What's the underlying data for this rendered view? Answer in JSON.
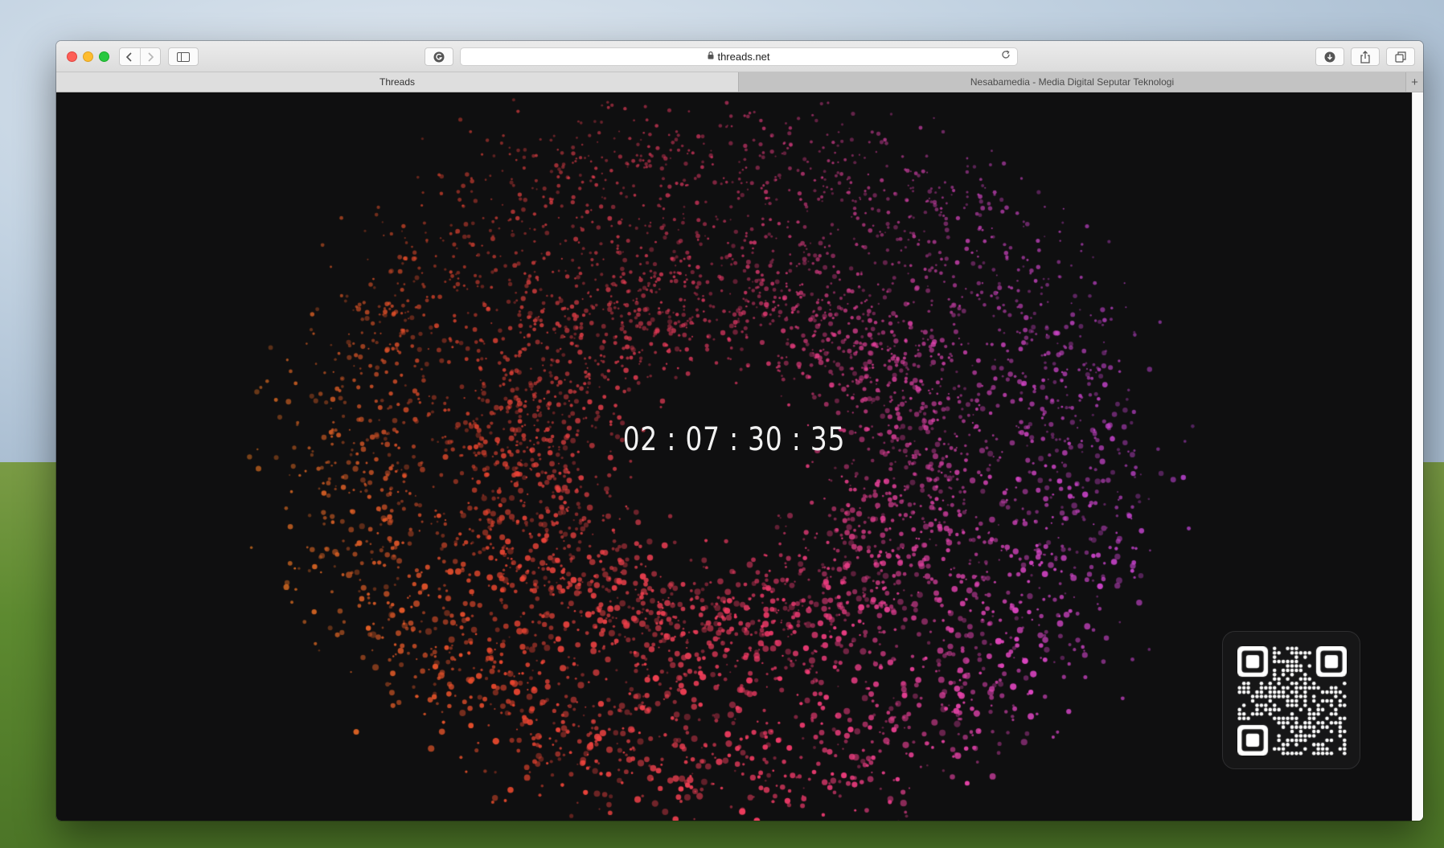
{
  "browser": {
    "url": "threads.net",
    "tabs": [
      {
        "label": "Threads",
        "active": true
      },
      {
        "label": "Nesabamedia - Media Digital Seputar Teknologi",
        "active": false
      }
    ],
    "new_tab_label": "+"
  },
  "page": {
    "countdown": "02 : 07 : 30 : 35",
    "background_color": "#0f0f10",
    "particle_gradient": [
      "#d97a1e",
      "#e8452e",
      "#f03a6a",
      "#d946c8",
      "#a43fd6"
    ]
  },
  "icons": {
    "back": "chevron-left-icon",
    "forward": "chevron-right-icon",
    "sidebar": "sidebar-icon",
    "extension": "grammarly-icon",
    "lock": "lock-icon",
    "reload": "reload-icon",
    "download": "download-icon",
    "share": "share-icon",
    "tabs": "tab-overview-icon",
    "qr": "qr-code-icon"
  }
}
